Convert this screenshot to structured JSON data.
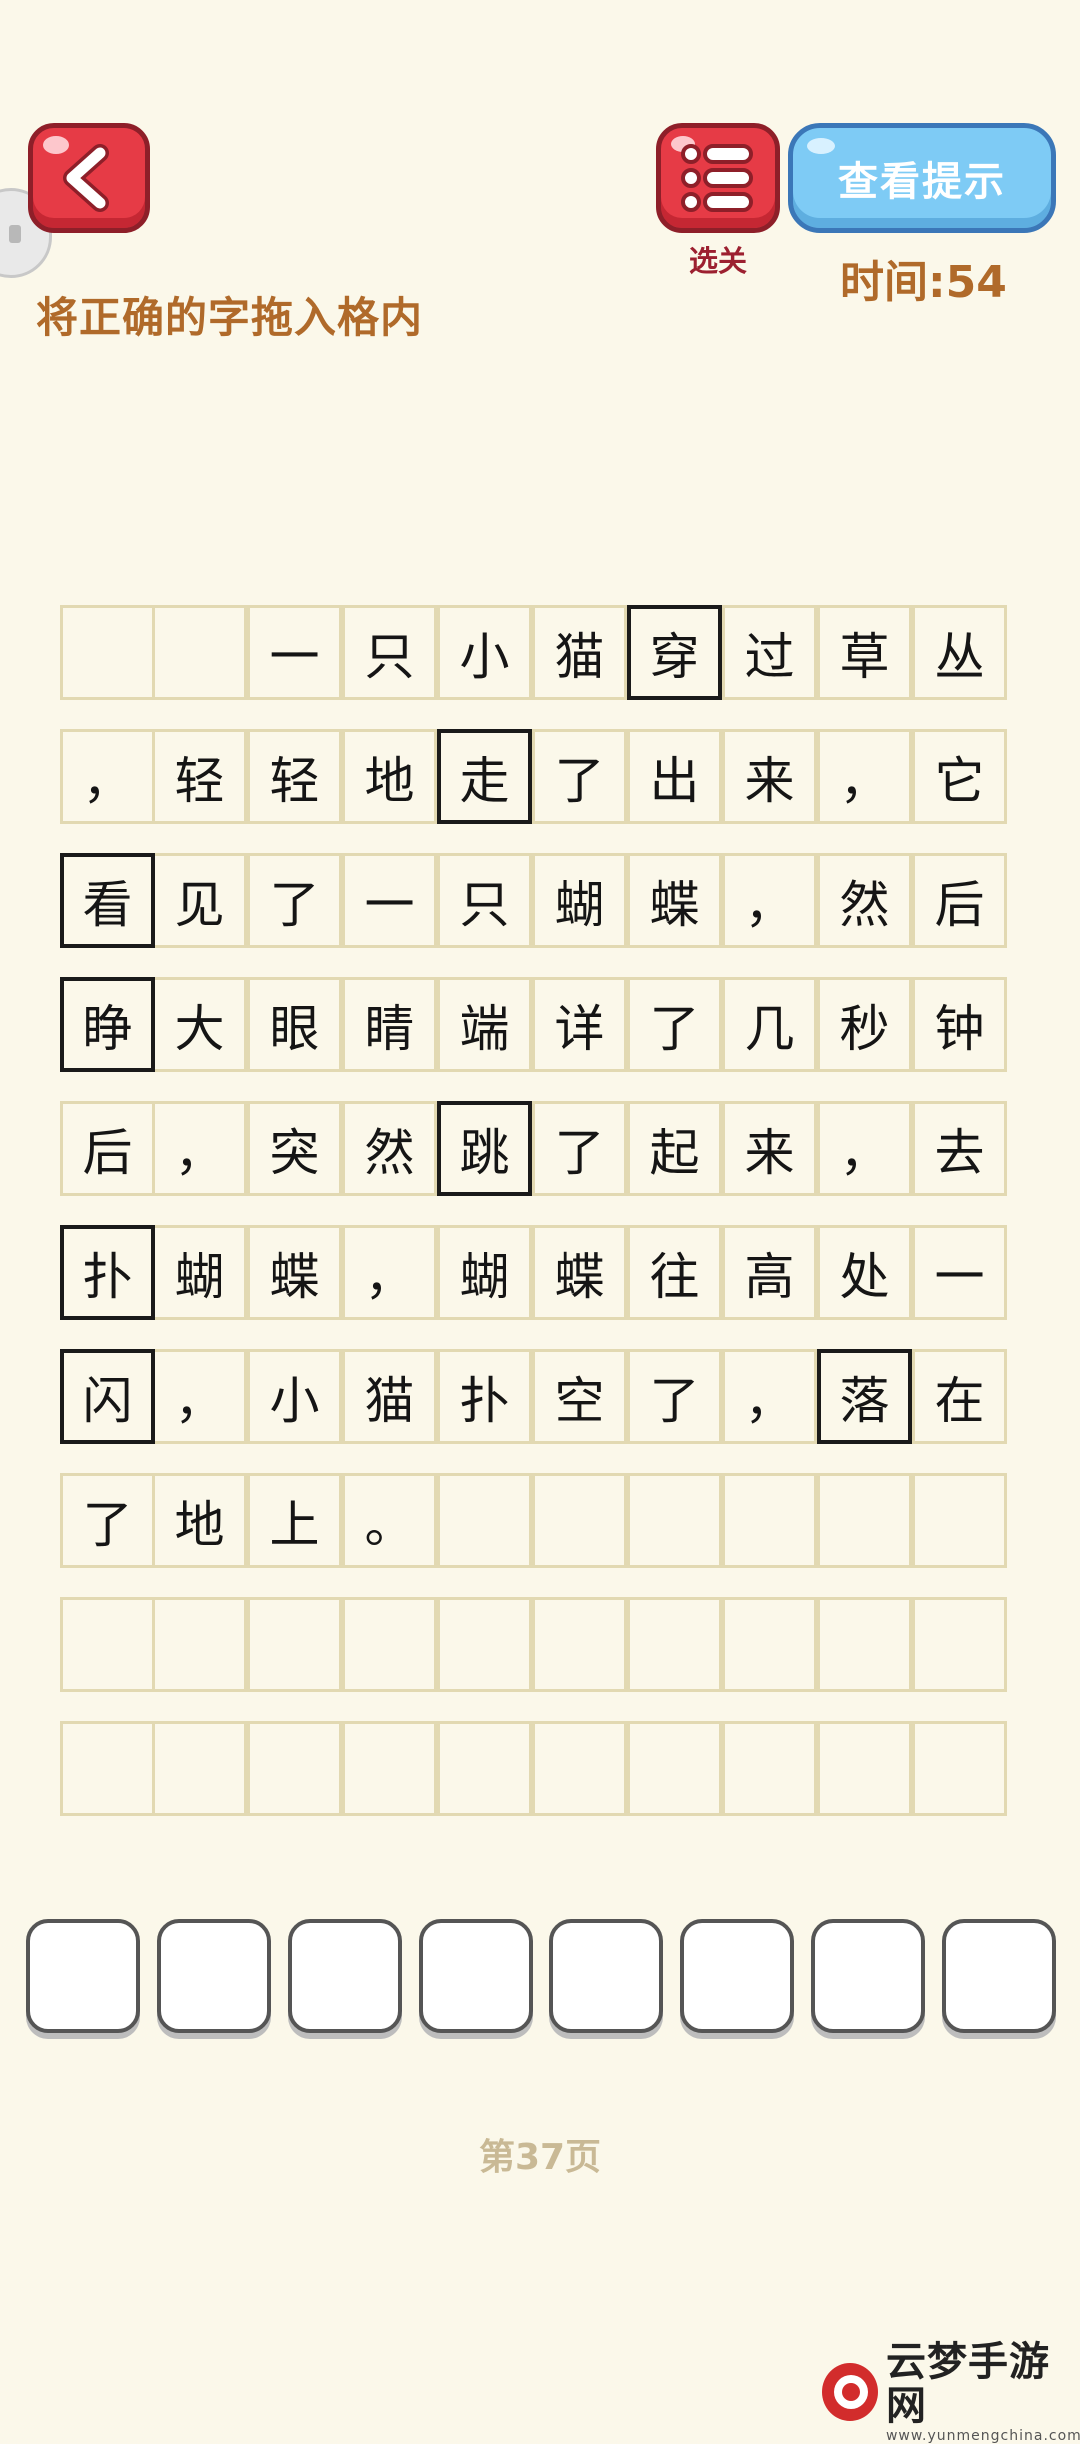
{
  "header": {
    "menu_label": "选关",
    "hint_label": "查看提示",
    "timer": "时间:54",
    "instruction": "将正确的字拖入格内"
  },
  "grid": {
    "rows": [
      [
        "",
        "",
        "一",
        "只",
        "小",
        "猫",
        "穿",
        "过",
        "草",
        "丛"
      ],
      [
        "，",
        "轻",
        "轻",
        "地",
        "走",
        "了",
        "出",
        "来",
        "，",
        "它"
      ],
      [
        "看",
        "见",
        "了",
        "一",
        "只",
        "蝴",
        "蝶",
        "，",
        "然",
        "后"
      ],
      [
        "睁",
        "大",
        "眼",
        "睛",
        "端",
        "详",
        "了",
        "几",
        "秒",
        "钟"
      ],
      [
        "后",
        "，",
        "突",
        "然",
        "跳",
        "了",
        "起",
        "来",
        "，",
        "去"
      ],
      [
        "扑",
        "蝴",
        "蝶",
        "，",
        "蝴",
        "蝶",
        "往",
        "高",
        "处",
        "一"
      ],
      [
        "闪",
        "，",
        "小",
        "猫",
        "扑",
        "空",
        "了",
        "，",
        "落",
        "在"
      ],
      [
        "了",
        "地",
        "上",
        "。",
        "",
        "",
        "",
        "",
        "",
        ""
      ],
      [
        "",
        "",
        "",
        "",
        "",
        "",
        "",
        "",
        "",
        ""
      ],
      [
        "",
        "",
        "",
        "",
        "",
        "",
        "",
        "",
        "",
        ""
      ]
    ],
    "highlighted": [
      [
        0,
        6
      ],
      [
        1,
        4
      ],
      [
        2,
        0
      ],
      [
        3,
        0
      ],
      [
        4,
        4
      ],
      [
        5,
        0
      ],
      [
        6,
        0
      ],
      [
        6,
        8
      ]
    ]
  },
  "answer_tiles": [
    "",
    "",
    "",
    "",
    "",
    "",
    "",
    ""
  ],
  "page_number": "第37页",
  "watermark": {
    "name": "云梦手游网",
    "url": "www.yunmengchina.com"
  }
}
